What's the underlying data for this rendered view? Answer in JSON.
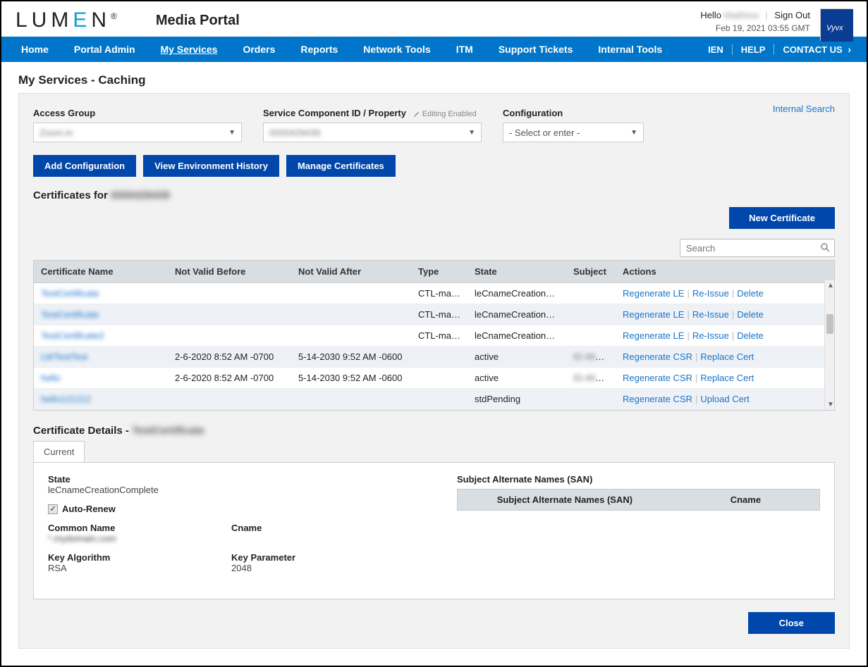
{
  "header": {
    "logo_pre": "LUM",
    "logo_accent": "E",
    "logo_post": "N",
    "logo_reg": "®",
    "portal_title": "Media Portal",
    "hello": "Hello",
    "username_blurred": "Matthew",
    "sign_out": "Sign Out",
    "timestamp": "Feb 19, 2021 03:55 GMT"
  },
  "nav": {
    "items": [
      "Home",
      "Portal Admin",
      "My Services",
      "Orders",
      "Reports",
      "Network Tools",
      "ITM",
      "Support Tickets",
      "Internal Tools"
    ],
    "active_index": 2,
    "right": {
      "ien": "IEN",
      "help": "HELP",
      "contact": "CONTACT US"
    }
  },
  "page": {
    "title": "My Services - Caching"
  },
  "panel": {
    "internal_search": "Internal Search",
    "filters": {
      "access_group": {
        "label": "Access Group",
        "value": "Zoom.in"
      },
      "scid": {
        "label": "Service Component ID / Property",
        "editing": "Editing Enabled",
        "value": "0000429439"
      },
      "config": {
        "label": "Configuration",
        "placeholder": "- Select or enter -"
      }
    },
    "buttons": {
      "add_config": "Add Configuration",
      "view_env": "View Environment History",
      "manage_certs": "Manage Certificates"
    },
    "cert_for_label": "Certificates for",
    "cert_for_value": "0000429439",
    "new_cert": "New Certificate",
    "search_placeholder": "Search",
    "table": {
      "headers": [
        "Certificate Name",
        "Not Valid Before",
        "Not Valid After",
        "Type",
        "State",
        "Subject",
        "Actions"
      ],
      "rows": [
        {
          "name": "TestCertificate",
          "before": "",
          "after": "",
          "type": "CTL-man…",
          "state": "leCnameCreation…",
          "subject": "",
          "actions": [
            "Regenerate LE",
            "Re-Issue",
            "Delete"
          ]
        },
        {
          "name": "TestCertificate",
          "before": "",
          "after": "",
          "type": "CTL-man…",
          "state": "leCnameCreation…",
          "subject": "",
          "actions": [
            "Regenerate LE",
            "Re-Issue",
            "Delete"
          ]
        },
        {
          "name": "TestCertificate2",
          "before": "",
          "after": "",
          "type": "CTL-man…",
          "state": "leCnameCreation…",
          "subject": "",
          "actions": [
            "Regenerate LE",
            "Re-Issue",
            "Delete"
          ]
        },
        {
          "name": "LWTestTest",
          "before": "2-6-2020 8:52 AM -0700",
          "after": "5-14-2030 9:52 AM -0600",
          "type": "",
          "state": "active",
          "subject": "ID:4962,ST=…",
          "actions": [
            "Regenerate CSR",
            "Replace Cert"
          ]
        },
        {
          "name": "hello",
          "before": "2-6-2020 8:52 AM -0700",
          "after": "5-14-2030 9:52 AM -0600",
          "type": "",
          "state": "active",
          "subject": "ID:4962,ST=…",
          "actions": [
            "Regenerate CSR",
            "Replace Cert"
          ]
        },
        {
          "name": "hello121212",
          "before": "",
          "after": "",
          "type": "",
          "state": "stdPending",
          "subject": "",
          "actions": [
            "Regenerate CSR",
            "Upload Cert"
          ]
        }
      ]
    },
    "details": {
      "title_label": "Certificate Details -",
      "title_value": "TestCertificate",
      "tab": "Current",
      "state_label": "State",
      "state_value": "leCnameCreationComplete",
      "auto_renew": "Auto-Renew",
      "auto_renew_checked": true,
      "common_name_label": "Common Name",
      "common_name_value": "*.mydomain.com",
      "cname_label": "Cname",
      "key_alg_label": "Key Algorithm",
      "key_alg_value": "RSA",
      "key_param_label": "Key Parameter",
      "key_param_value": "2048",
      "san_title": "Subject Alternate Names (SAN)",
      "san_col1": "Subject Alternate Names (SAN)",
      "san_col2": "Cname"
    },
    "close": "Close"
  }
}
